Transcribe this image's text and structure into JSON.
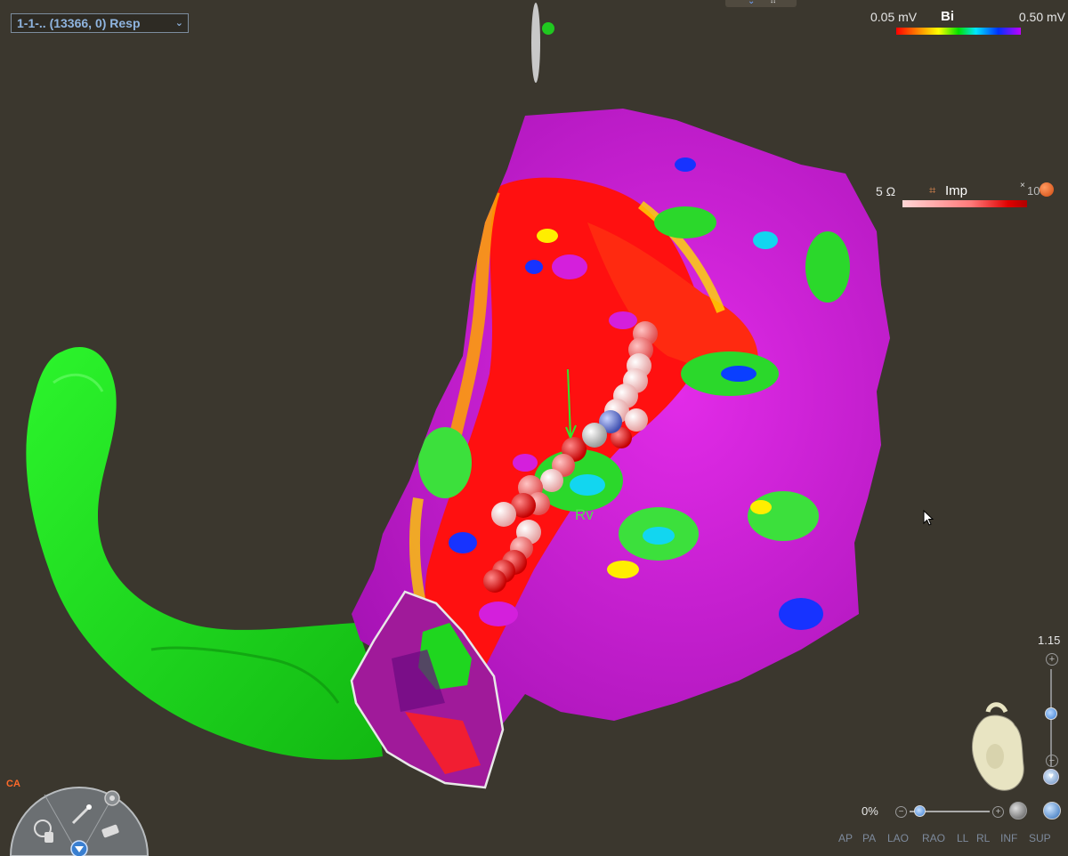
{
  "map_selector": {
    "label": "1-1-.. (13366, 0) Resp",
    "chevron": "⌄"
  },
  "top_controls": {
    "chevron": "⌄",
    "dots": "⠿"
  },
  "bi_legend": {
    "min": "0.05 mV",
    "name": "Bi",
    "max": "0.50 mV"
  },
  "imp_legend": {
    "value": "5 Ω",
    "name": "Imp",
    "max_value": "10",
    "close": "×"
  },
  "zoom": {
    "value": "1.15",
    "plus": "+",
    "minus": "−",
    "level_fraction": 0.55
  },
  "opacity": {
    "value": "0%",
    "minus": "−",
    "plus": "+",
    "level_fraction": 0.0
  },
  "views": [
    "AP",
    "PA",
    "LAO",
    "RAO",
    "LL",
    "RL",
    "INF",
    "SUP"
  ],
  "model_label": "Rv",
  "tool_logo": "CA"
}
